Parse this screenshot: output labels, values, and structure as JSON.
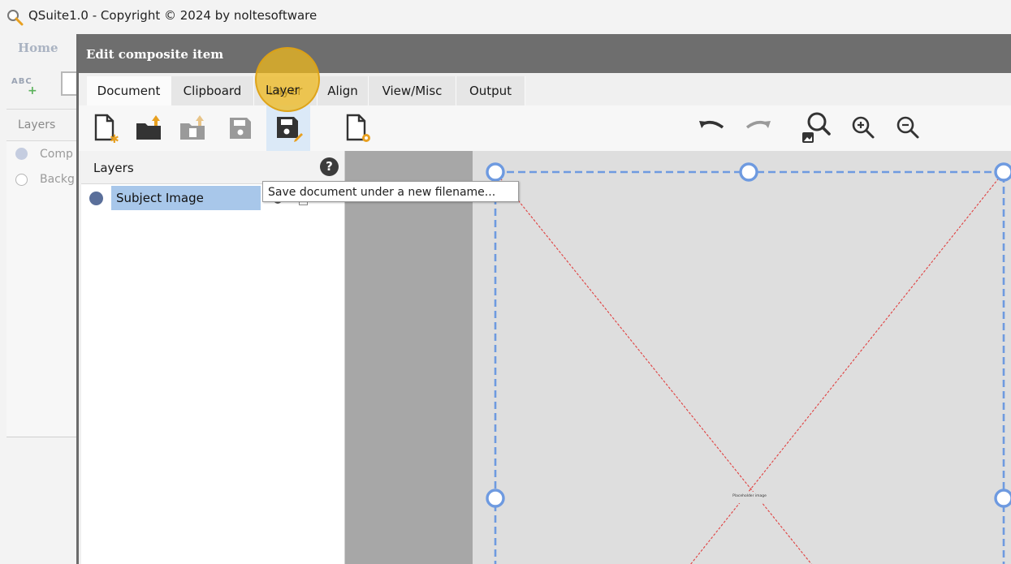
{
  "window": {
    "title": "QSuite1.0 - Copyright © 2024 by noltesoftware",
    "app_icon": "magnifier-icon"
  },
  "background_app": {
    "home_label": "Home",
    "abc_label": "ABC",
    "layers_label": "Layers",
    "items": [
      {
        "label": "Comp",
        "selected": true
      },
      {
        "label": "Backg",
        "selected": false
      }
    ]
  },
  "dialog": {
    "title": "Edit composite item",
    "tabs": [
      {
        "label": "Document",
        "active": true
      },
      {
        "label": "Clipboard",
        "active": false
      },
      {
        "label": "Layer",
        "active": false
      },
      {
        "label": "Align",
        "active": false
      },
      {
        "label": "View/Misc",
        "active": false
      },
      {
        "label": "Output",
        "active": false
      }
    ],
    "toolbar_left": [
      {
        "icon": "new-document-icon",
        "enabled": true
      },
      {
        "icon": "open-folder-icon",
        "enabled": true
      },
      {
        "icon": "import-icon",
        "enabled": false
      },
      {
        "icon": "save-icon",
        "enabled": false
      },
      {
        "icon": "save-as-icon",
        "enabled": true,
        "hovered": true
      },
      {
        "icon": "document-settings-icon",
        "enabled": true
      }
    ],
    "toolbar_right": [
      {
        "icon": "undo-icon",
        "enabled": true
      },
      {
        "icon": "redo-icon",
        "enabled": false
      },
      {
        "icon": "zoom-fit-icon",
        "enabled": true
      },
      {
        "icon": "zoom-in-icon",
        "enabled": true
      },
      {
        "icon": "zoom-out-icon",
        "enabled": true
      }
    ],
    "layers_panel": {
      "title": "Layers",
      "help_glyph": "?",
      "layers": [
        {
          "name": "Subject Image",
          "selected": true
        }
      ]
    },
    "tooltip": "Save document under a new filename...",
    "canvas": {
      "placeholder_text": "Placeholder image"
    }
  },
  "colors": {
    "dialog_header": "#6e6e6e",
    "selection": "#a8c7ea",
    "hover_button": "#dbe9f7",
    "handle_blue": "#6e9ae0",
    "cross_red": "#e04040",
    "cursor_highlight": "#eeb81e"
  }
}
